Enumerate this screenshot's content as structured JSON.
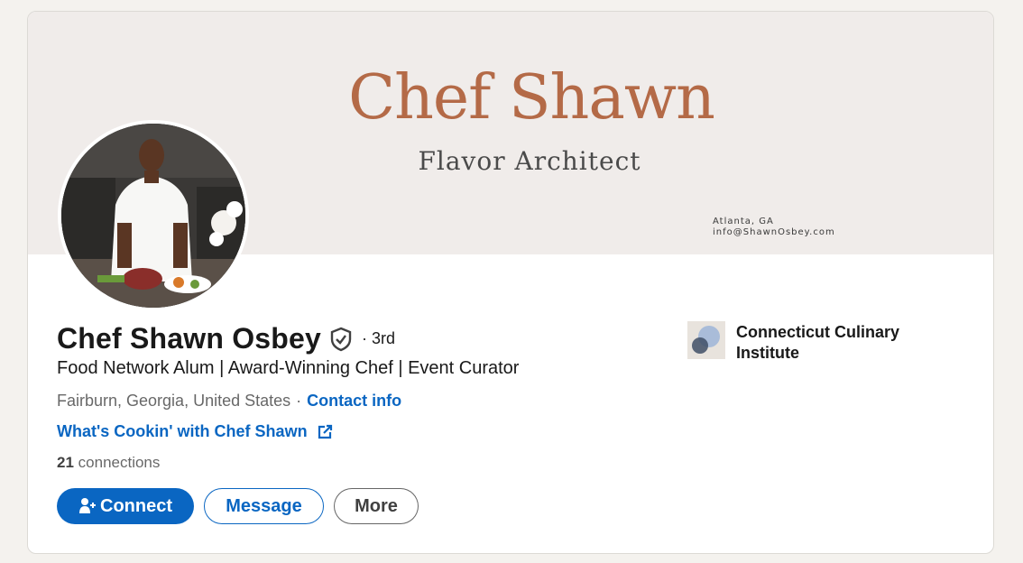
{
  "banner": {
    "title": "Chef Shawn",
    "subtitle": "Flavor Architect",
    "location": "Atlanta, GA",
    "email": "info@ShawnOsbey.com"
  },
  "profile": {
    "name": "Chef Shawn Osbey",
    "degree": "· 3rd",
    "headline": "Food Network Alum | Award-Winning Chef | Event Curator",
    "location": "Fairburn, Georgia, United States",
    "separator": "·",
    "contact_label": "Contact info",
    "website_label": "What's Cookin' with Chef Shawn",
    "connections_count": "21",
    "connections_label": "connections"
  },
  "actions": {
    "connect": "Connect",
    "message": "Message",
    "more": "More"
  },
  "education": {
    "name": "Connecticut Culinary Institute"
  },
  "colors": {
    "accent": "#0a66c2",
    "banner_title": "#b46a47",
    "banner_bg": "#f0ecea"
  },
  "icons": [
    "verified-shield-icon",
    "external-link-icon",
    "add-person-icon",
    "school-logo-icon"
  ]
}
